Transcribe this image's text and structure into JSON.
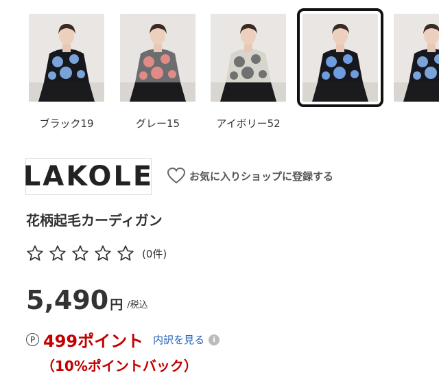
{
  "color_variants": [
    {
      "label": "ブラック19",
      "bg": "#e9e6e3",
      "base": "#16181d",
      "flower": "#7aa3d9",
      "selected": false
    },
    {
      "label": "グレー15",
      "bg": "#e7e4e1",
      "base": "#6d6d70",
      "flower": "#e08b86",
      "selected": false
    },
    {
      "label": "アイボリー52",
      "bg": "#e9e6e3",
      "base": "#d8d5cc",
      "flower": "#6f7270",
      "selected": false
    },
    {
      "label": "",
      "bg": "#e9e6e3",
      "base": "#16181d",
      "flower": "#6f9be0",
      "selected": true
    },
    {
      "label": "",
      "bg": "#e9e6e3",
      "base": "#16181d",
      "flower": "#7aa3d9",
      "selected": false
    }
  ],
  "shop": {
    "logo_text": "LAKOLE",
    "favorite_label": "お気に入りショップに登録する",
    "favorite_icon": "heart-outline-icon"
  },
  "product": {
    "name": "花柄起毛カーディガン",
    "rating_stars": 0,
    "review_count": "(0件)",
    "price": "5,490",
    "currency": "円",
    "tax_note": "/税込"
  },
  "points": {
    "symbol": "P",
    "value": "499ポイント",
    "breakdown_link": "内訳を見る",
    "info_icon": "i",
    "back_text": "（10%ポイントバック）"
  },
  "colors": {
    "point_red": "#c10000",
    "link_blue": "#2563b8"
  }
}
